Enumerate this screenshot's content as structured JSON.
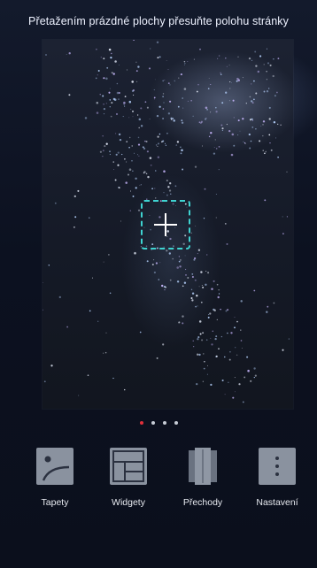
{
  "header": {
    "hint": "Přetažením prázdné plochy přesuňte polohu stránky"
  },
  "pager": {
    "count": 4,
    "active": 0,
    "active_color": "#e0303a"
  },
  "add_button": {
    "icon": "plus-icon",
    "accent": "#3fd3d1"
  },
  "toolbar": {
    "items": [
      {
        "label": "Tapety",
        "icon": "wallpaper-icon"
      },
      {
        "label": "Widgety",
        "icon": "widgets-icon"
      },
      {
        "label": "Přechody",
        "icon": "transitions-icon"
      },
      {
        "label": "Nastavení",
        "icon": "settings-icon"
      }
    ]
  }
}
